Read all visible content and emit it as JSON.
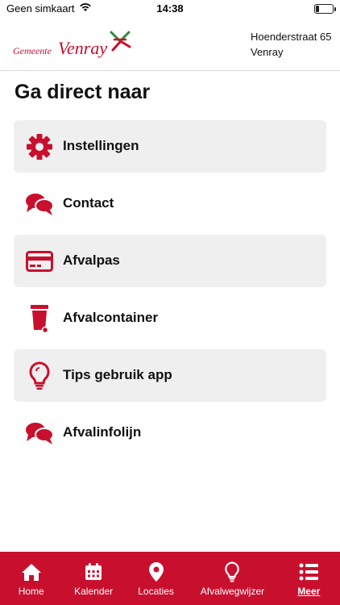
{
  "status_bar": {
    "carrier": "Geen simkaart",
    "time": "14:38"
  },
  "header": {
    "logo_small": "Gemeente",
    "logo_big": "Venray",
    "address_line1": "Hoenderstraat 65",
    "address_line2": "Venray"
  },
  "main": {
    "title": "Ga direct naar",
    "items": [
      {
        "label": "Instellingen",
        "icon": "gear-icon"
      },
      {
        "label": "Contact",
        "icon": "chat-bubbles-icon"
      },
      {
        "label": "Afvalpas",
        "icon": "card-icon"
      },
      {
        "label": "Afvalcontainer",
        "icon": "wheelie-bin-icon"
      },
      {
        "label": "Tips gebruik app",
        "icon": "lightbulb-icon"
      },
      {
        "label": "Afvalinfolijn",
        "icon": "chat-bubbles-icon"
      }
    ]
  },
  "tab_bar": {
    "tabs": [
      {
        "label": "Home",
        "icon": "home-icon"
      },
      {
        "label": "Kalender",
        "icon": "calendar-icon"
      },
      {
        "label": "Locaties",
        "icon": "location-pin-icon"
      },
      {
        "label": "Afvalwegwijzer",
        "icon": "lightbulb-icon"
      },
      {
        "label": "Meer",
        "icon": "list-icon",
        "active": true
      }
    ]
  },
  "colors": {
    "brand_red": "#c8102e",
    "shaded_row": "#efefef",
    "text": "#111111"
  }
}
